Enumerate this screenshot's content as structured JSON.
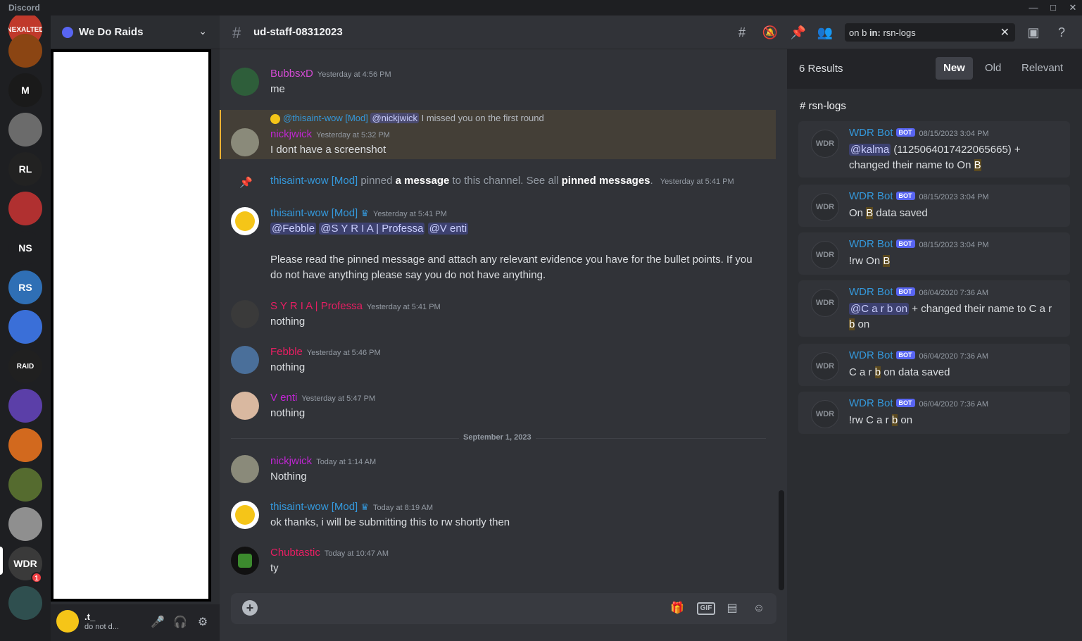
{
  "window": {
    "app_name": "Discord"
  },
  "servers": [
    {
      "label": "NEXALTED",
      "color": "#c0392b"
    },
    {
      "label": "",
      "color": "#8b4513"
    },
    {
      "label": "M",
      "color": "#1a1a1a"
    },
    {
      "label": "",
      "color": "#6b6b6b"
    },
    {
      "label": "RL",
      "color": "#222222"
    },
    {
      "label": "",
      "color": "#b03030"
    },
    {
      "label": "NS",
      "color": "#1e1f22"
    },
    {
      "label": "RS",
      "color": "#2f6fb5"
    },
    {
      "label": "",
      "color": "#3a6fd8"
    },
    {
      "label": "RAID",
      "color": "#202020"
    },
    {
      "label": "",
      "color": "#5b3fa8"
    },
    {
      "label": "",
      "color": "#d2691e"
    },
    {
      "label": "",
      "color": "#556b2f"
    },
    {
      "label": "",
      "color": "#8f8f8f"
    },
    {
      "label": "WDR",
      "color": "#3a3a3a",
      "badge": "1"
    },
    {
      "label": "",
      "color": "#2f4f4f"
    }
  ],
  "guild": {
    "name": "We Do Raids"
  },
  "user": {
    "name": ".t_",
    "status": "do not d..."
  },
  "channel": {
    "name": "ud-staff-08312023"
  },
  "search": {
    "query": "on b",
    "in_label": "in:",
    "in_channel": "rsn-logs"
  },
  "messages": {
    "m1": {
      "author": "BubbsxD",
      "time": "Yesterday at 4:56 PM",
      "text": "me",
      "color": "#e91e63"
    },
    "m2": {
      "reply_author": "@thisaint-wow [Mod]",
      "reply_mention": "@nickjwick",
      "reply_text": "I missed you on the first round",
      "author": "nickjwick",
      "time": "Yesterday at 5:32 PM",
      "text": "I dont have a screenshot"
    },
    "pin": {
      "author": "thisaint-wow [Mod]",
      "t1": "pinned",
      "t2": "a message",
      "t3": "to this channel. See all",
      "t4": "pinned messages",
      "t5": ".",
      "time": "Yesterday at 5:41 PM"
    },
    "m3": {
      "author": "thisaint-wow [Mod]",
      "time": "Yesterday at 5:41 PM",
      "mentions": [
        "@Febble",
        "@S Y R I A | Professa",
        "@V enti"
      ],
      "text": "Please read the pinned message and attach any relevant evidence you have for the bullet points. If you do not have anything please say you do not have anything."
    },
    "m4": {
      "author": "S Y R I A | Professa",
      "time": "Yesterday at 5:41 PM",
      "text": "nothing"
    },
    "m5": {
      "author": "Febble",
      "time": "Yesterday at 5:46 PM",
      "text": "nothing"
    },
    "m6": {
      "author": "V enti",
      "time": "Yesterday at 5:47 PM",
      "text": "nothing"
    },
    "divider": "September 1, 2023",
    "m7": {
      "author": "nickjwick",
      "time": "Today at 1:14 AM",
      "text": "Nothing"
    },
    "m8": {
      "author": "thisaint-wow [Mod]",
      "time": "Today at 8:19 AM",
      "text": "ok thanks, i will be submitting this to rw shortly then"
    },
    "m9": {
      "author": "Chubtastic",
      "time": "Today at 10:47 AM",
      "text": "ty"
    }
  },
  "results": {
    "count": "6 Results",
    "tabs": [
      "New",
      "Old",
      "Relevant"
    ],
    "channel": "# rsn-logs",
    "bot_name": "WDR Bot",
    "bot_tag": "BOT",
    "avatar_text": "WDR",
    "items": [
      {
        "time": "08/15/2023 3:04 PM",
        "mention": "@kalma",
        "a": " (1125064017422065665) + changed their name to On ",
        "hl": "B",
        "b": ""
      },
      {
        "time": "08/15/2023 3:04 PM",
        "mention": "",
        "a": "On ",
        "hl": "B",
        "b": " data saved"
      },
      {
        "time": "08/15/2023 3:04 PM",
        "mention": "",
        "a": "!rw On ",
        "hl": "B",
        "b": ""
      },
      {
        "time": "06/04/2020 7:36 AM",
        "mention": "@C a r b on",
        "a": " + changed their name to C a r ",
        "hl": "b",
        "b": " on"
      },
      {
        "time": "06/04/2020 7:36 AM",
        "mention": "",
        "a": "C a r ",
        "hl": "b",
        "b": " on data saved"
      },
      {
        "time": "06/04/2020 7:36 AM",
        "mention": "",
        "a": "!rw C a r ",
        "hl": "b",
        "b": " on"
      }
    ]
  },
  "colors": {
    "accent": "#5865f2",
    "mod": "#3498db",
    "pink": "#e91e63",
    "magenta": "#c026d3"
  }
}
